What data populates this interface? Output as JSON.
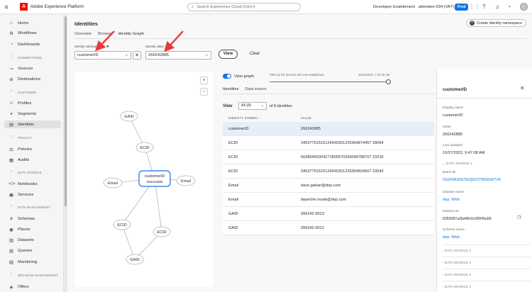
{
  "topbar": {
    "app_title": "Adobe Experience Platform",
    "search_placeholder": "Search Experience Cloud (Ctrl+/)",
    "org": "Developer Enablement",
    "sandbox": "attendee-034 (VA7)",
    "env_badge": "Prod"
  },
  "sidebar": {
    "items": [
      {
        "label": "Home",
        "icon": "home-icon"
      },
      {
        "label": "Workflows",
        "icon": "workflows-icon"
      },
      {
        "label": "Dashboards",
        "icon": "dashboards-icon"
      }
    ],
    "sections": [
      {
        "title": "CONNECTIONS",
        "items": [
          "Sources",
          "Destinations"
        ]
      },
      {
        "title": "CUSTOMER",
        "items": [
          "Profiles",
          "Segments",
          "Identities"
        ]
      },
      {
        "title": "PRIVACY",
        "items": [
          "Policies",
          "Audits"
        ]
      },
      {
        "title": "DATA SCIENCE",
        "items": [
          "Notebooks",
          "Services"
        ]
      },
      {
        "title": "DATA MANAGEMENT",
        "items": [
          "Schemas",
          "Places",
          "Datasets",
          "Queries",
          "Monitoring"
        ]
      },
      {
        "title": "DECISION MANAGEMENT",
        "items": [
          "Offers"
        ]
      }
    ]
  },
  "page": {
    "title": "Identities",
    "create_button": "Create identity namespace",
    "tabs": [
      "Overview",
      "Browse",
      "Identity Graph"
    ],
    "active_tab": "Identity Graph"
  },
  "form": {
    "namespace_label": "Identity namespace",
    "namespace_value": "customerID",
    "value_label": "Identity value",
    "value_value": "266242885",
    "view_button": "View",
    "clear_button": "Clear"
  },
  "graph": {
    "nodes": [
      {
        "label": "GAID"
      },
      {
        "label": "ECID"
      },
      {
        "label": "Email"
      },
      {
        "label": "customerID",
        "sub": "266242885"
      },
      {
        "label": "Email"
      },
      {
        "label": "ECID"
      },
      {
        "label": "ECID"
      },
      {
        "label": "GAID"
      }
    ]
  },
  "detail": {
    "view_graph": "View graph",
    "filter_label": "Filter by the time the link was established",
    "filter_date": "10/19/2022, 7:33:18 AM",
    "tabs": [
      "Identities",
      "Data source"
    ],
    "view_label": "View",
    "select_value": "All (8)",
    "count_text": "of 8 identities",
    "col_symbol": "IDENTITY SYMBOL",
    "col_value": "VALUE",
    "rows": [
      {
        "symbol": "customerID",
        "value": "266242885",
        "selected": true
      },
      {
        "symbol": "ECID",
        "value": "34537751515124345301225364874457 28054"
      },
      {
        "symbol": "ECID",
        "value": "66385493304271800570266048788707 23316"
      },
      {
        "symbol": "ECID",
        "value": "34537751515124345301225364834567 23542"
      },
      {
        "symbol": "Email",
        "value": "dave.gahan@dep.com"
      },
      {
        "symbol": "Email",
        "value": "depeche.mode@dep.com"
      },
      {
        "symbol": "GAID",
        "value": "266242-9013"
      },
      {
        "symbol": "GAID",
        "value": "266242-9012"
      }
    ]
  },
  "rail": {
    "title": "customerID",
    "fields": [
      {
        "key": "Display name",
        "value": "customerID"
      },
      {
        "key": "Value",
        "value": "266242885"
      },
      {
        "key": "Last updated",
        "value": "10/27/2022, 9:47:08 AM"
      }
    ],
    "source1": "DATA SOURCE 1",
    "batch_key": "Batch ID",
    "batch_value": "01GFRA3D675XQEF37HNSGW7VK",
    "dataset_name_key": "Dataset name",
    "dataset_name_value": "dep: Web",
    "dataset_id_key": "Dataset ID",
    "dataset_id_value": "6350087a3bd48c6c09045a58",
    "schema_key": "Schema name",
    "schema_value": "dep: Web",
    "more_sources": [
      "DATA SOURCE 2",
      "DATA SOURCE 3",
      "DATA SOURCE 4",
      "DATA SOURCE 5"
    ]
  },
  "colors": {
    "accent": "#1473e6",
    "annotation_arrow": "#e8393b",
    "check": "#2d9d78"
  }
}
